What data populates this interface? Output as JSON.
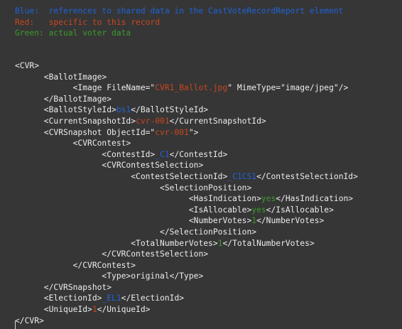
{
  "legend": {
    "blue": "Blue:  references to shared data in the CastVoteRecordReport element",
    "red": "Red:   specific to this record",
    "green": "Green: actual voter data"
  },
  "colors": {
    "blue": "#1f63d8",
    "red": "#c8461e",
    "green": "#3f9a2c",
    "text": "#ececec",
    "background": "#363636"
  },
  "lines": [
    [
      {
        "t": "<CVR>"
      }
    ],
    [
      {
        "t": "      <BallotImage>"
      }
    ],
    [
      {
        "t": "            <Image FileName=\""
      },
      {
        "t": "CVR1_Ballot.jpg",
        "c": "red"
      },
      {
        "t": "\" MimeType=\"image/jpeg\"/>"
      }
    ],
    [
      {
        "t": "      </BallotImage>"
      }
    ],
    [
      {
        "t": "      <BallotStyleId>"
      },
      {
        "t": "bs1",
        "c": "blue"
      },
      {
        "t": "</BallotStyleId>"
      }
    ],
    [
      {
        "t": "      <CurrentSnapshotId>"
      },
      {
        "t": "cvr-001",
        "c": "red"
      },
      {
        "t": "</CurrentSnapshotId>"
      }
    ],
    [
      {
        "t": "      <CVRSnapshot ObjectId=\""
      },
      {
        "t": "cvr-001",
        "c": "red"
      },
      {
        "t": "\">"
      }
    ],
    [
      {
        "t": "            <CVRContest>"
      }
    ],
    [
      {
        "t": "                  <ContestId>"
      },
      {
        "t": "_C1",
        "c": "blue"
      },
      {
        "t": "</ContestId>"
      }
    ],
    [
      {
        "t": "                  <CVRContestSelection>"
      }
    ],
    [
      {
        "t": "                        <ContestSelectionId>"
      },
      {
        "t": "_C1CS1",
        "c": "blue"
      },
      {
        "t": "</ContestSelectionId>"
      }
    ],
    [
      {
        "t": "                              <SelectionPosition>"
      }
    ],
    [
      {
        "t": "                                    <HasIndication>"
      },
      {
        "t": "yes",
        "c": "green"
      },
      {
        "t": "</HasIndication>"
      }
    ],
    [
      {
        "t": "                                    <IsAllocable>"
      },
      {
        "t": "yes",
        "c": "green"
      },
      {
        "t": "</IsAllocable>"
      }
    ],
    [
      {
        "t": "                                    <NumberVotes>"
      },
      {
        "t": "1",
        "c": "green"
      },
      {
        "t": "</NumberVotes>"
      }
    ],
    [
      {
        "t": "                              </SelectionPosition>"
      }
    ],
    [
      {
        "t": "                        <TotalNumberVotes>"
      },
      {
        "t": "1",
        "c": "green"
      },
      {
        "t": "</TotalNumberVotes>"
      }
    ],
    [
      {
        "t": "                  </CVRContestSelection>"
      }
    ],
    [
      {
        "t": "            </CVRContest>"
      }
    ],
    [
      {
        "t": "                  <Type>original</Type>"
      }
    ],
    [
      {
        "t": "      </CVRSnapshot>"
      }
    ],
    [
      {
        "t": "      <ElectionId>"
      },
      {
        "t": "_EL1",
        "c": "blue"
      },
      {
        "t": "</ElectionId>"
      }
    ],
    [
      {
        "t": "      <UniqueId>"
      },
      {
        "t": "1",
        "c": "red"
      },
      {
        "t": "</UniqueId>"
      }
    ],
    [
      {
        "t": "</CVR>"
      }
    ]
  ]
}
